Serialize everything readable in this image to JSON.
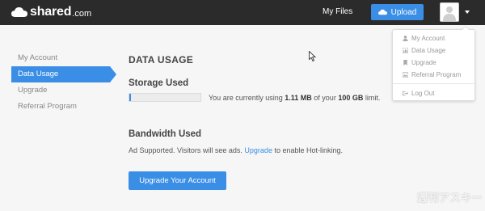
{
  "header": {
    "brand_name": "shared",
    "brand_tld": ".com",
    "my_files": "My Files",
    "upload": "Upload"
  },
  "sidebar": {
    "items": [
      {
        "label": "My Account"
      },
      {
        "label": "Data Usage"
      },
      {
        "label": "Upgrade"
      },
      {
        "label": "Referral Program"
      }
    ]
  },
  "main": {
    "title": "DATA USAGE",
    "storage": {
      "title": "Storage Used",
      "text_prefix": "You are currently using",
      "used": "1.11 MB",
      "text_middle": "of your",
      "limit": "100 GB",
      "text_suffix": "limit.",
      "used_fraction": 0.02
    },
    "bandwidth": {
      "title": "Bandwidth Used",
      "text_prefix": "Ad Supported. Visitors will see ads.",
      "link": "Upgrade",
      "text_suffix": "to enable Hot-linking."
    },
    "upgrade_button": "Upgrade Your Account"
  },
  "dropdown": {
    "items": [
      {
        "label": "My Account",
        "icon": "user-icon"
      },
      {
        "label": "Data Usage",
        "icon": "chart-icon"
      },
      {
        "label": "Upgrade",
        "icon": "bookmark-icon"
      },
      {
        "label": "Referral Program",
        "icon": "image-icon"
      },
      {
        "label": "Log Out",
        "icon": "logout-icon"
      }
    ]
  },
  "watermark": "週刊アスキー",
  "colors": {
    "accent": "#3a8ee6",
    "topbar": "#2b2b2b",
    "background": "#f6f6f6"
  }
}
